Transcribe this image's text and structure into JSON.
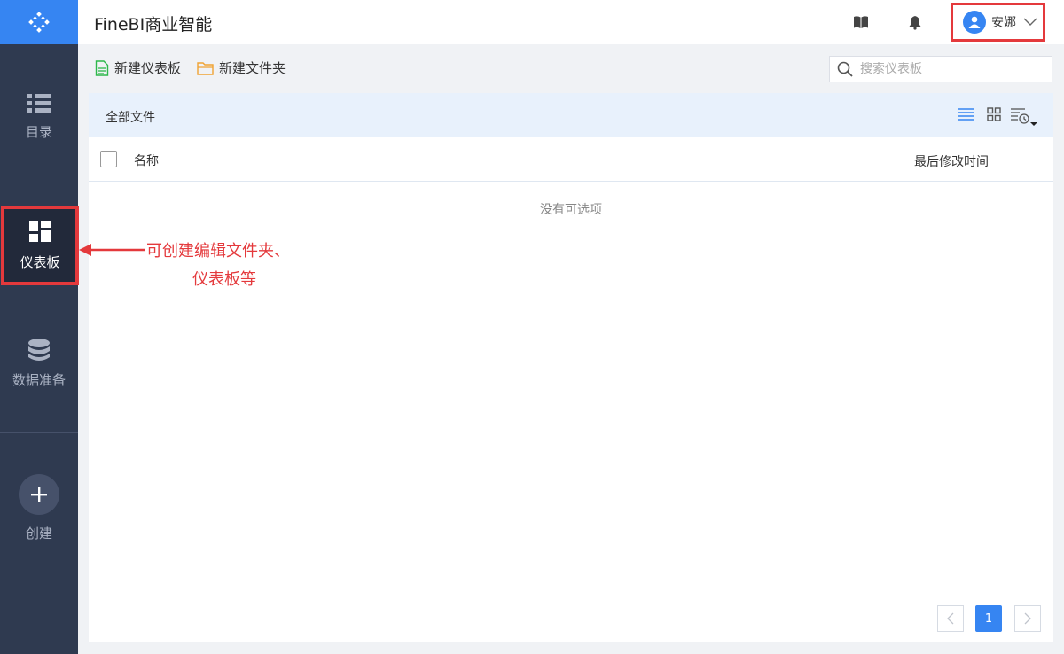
{
  "app": {
    "title": "FineBI商业智能"
  },
  "sidebar": {
    "items": [
      {
        "label": "目录",
        "icon": "list-icon"
      },
      {
        "label": "仪表板",
        "icon": "dashboard-icon",
        "active": true
      },
      {
        "label": "数据准备",
        "icon": "database-icon"
      },
      {
        "label": "创建",
        "icon": "plus-icon"
      }
    ]
  },
  "header": {
    "user_name": "安娜",
    "icons": [
      "book-icon",
      "bell-icon",
      "user-avatar-icon",
      "chevron-down-icon"
    ]
  },
  "toolbar": {
    "new_dashboard_label": "新建仪表板",
    "new_folder_label": "新建文件夹",
    "search_placeholder": "搜索仪表板"
  },
  "panel": {
    "title": "全部文件",
    "columns": [
      "名称",
      "最后修改时间"
    ],
    "empty_text": "没有可选项",
    "rows": []
  },
  "pagination": {
    "current_page": "1"
  },
  "annotation": {
    "line1": "可创建编辑文件夹、",
    "line2": "仪表板等"
  },
  "colors": {
    "accent": "#3685f2",
    "sidebar_bg": "#2f3a50",
    "highlight_red": "#e4393c",
    "panel_head_bg": "#e8f1fc"
  }
}
